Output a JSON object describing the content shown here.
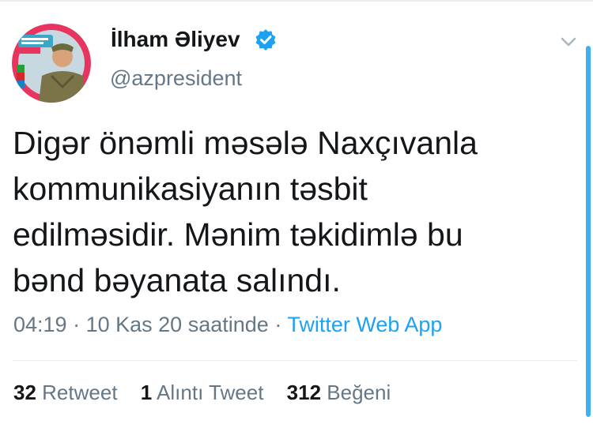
{
  "author": {
    "display_name": "İlham Əliyev",
    "handle": "@azpresident",
    "verified": true,
    "verified_color": "#1da1f2"
  },
  "tweet": {
    "text_lines": [
      "Digər önəmli məsələ Naxçıvanla",
      "kommunikasiyanın təsbit",
      "edilməsidir. Mənim təkidimlə bu",
      "bənd bəyanata salındı."
    ],
    "time": "04:19",
    "separator": "·",
    "date": "10 Kas 20 saatinde",
    "source": "Twitter Web App"
  },
  "stats": {
    "retweets_count": "32",
    "retweets_label": "Retweet",
    "quotes_count": "1",
    "quotes_label": "Alıntı Tweet",
    "likes_count": "312",
    "likes_label": "Beğeni"
  },
  "icons": {
    "menu": "chevron-down-icon",
    "verified": "verified-badge-icon"
  },
  "colors": {
    "link": "#1da1f2",
    "secondary_text": "#657786",
    "primary_text": "#14171a"
  }
}
